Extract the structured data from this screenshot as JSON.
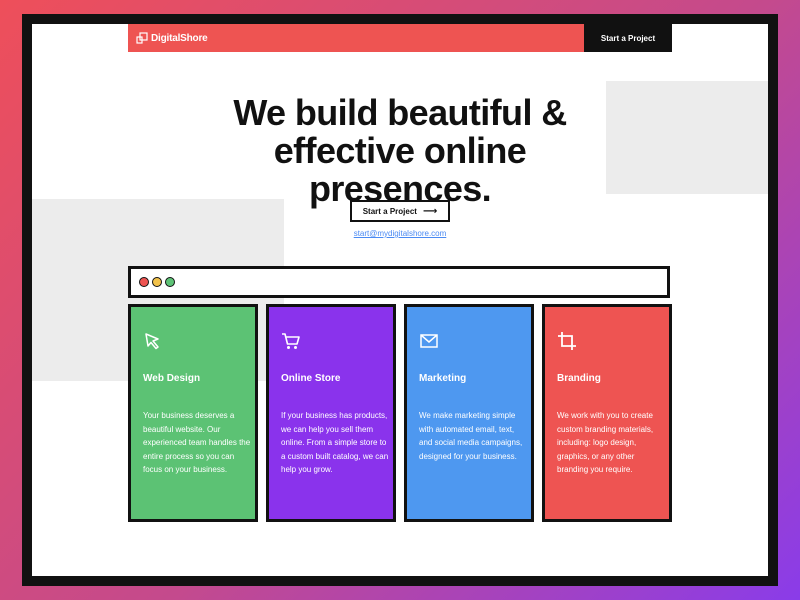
{
  "nav": {
    "logo_text": "DigitalShore",
    "cta_label": "Start a Project"
  },
  "hero": {
    "title": "We build beautiful & effective online presences.",
    "button_label": "Start a Project",
    "email": "start@mydigitalshore.com"
  },
  "cards": [
    {
      "title": "Web Design",
      "icon": "cursor-icon",
      "color": "#5cc274",
      "text": "Your business deserves a beautiful website. Our experienced team handles the entire process so you can focus on your business."
    },
    {
      "title": "Online Store",
      "icon": "cart-icon",
      "color": "#8a33ec",
      "text": "If your business has products, we can help you sell them online. From a simple store to a custom built catalog, we can help you grow."
    },
    {
      "title": "Marketing",
      "icon": "mail-icon",
      "color": "#4e98f0",
      "text": "We make marketing simple with automated email, text, and social media campaigns, designed for your business."
    },
    {
      "title": "Branding",
      "icon": "crop-icon",
      "color": "#ee5452",
      "text": "We work with you to create custom branding materials, including: logo design, graphics, or any other branding you require."
    }
  ]
}
